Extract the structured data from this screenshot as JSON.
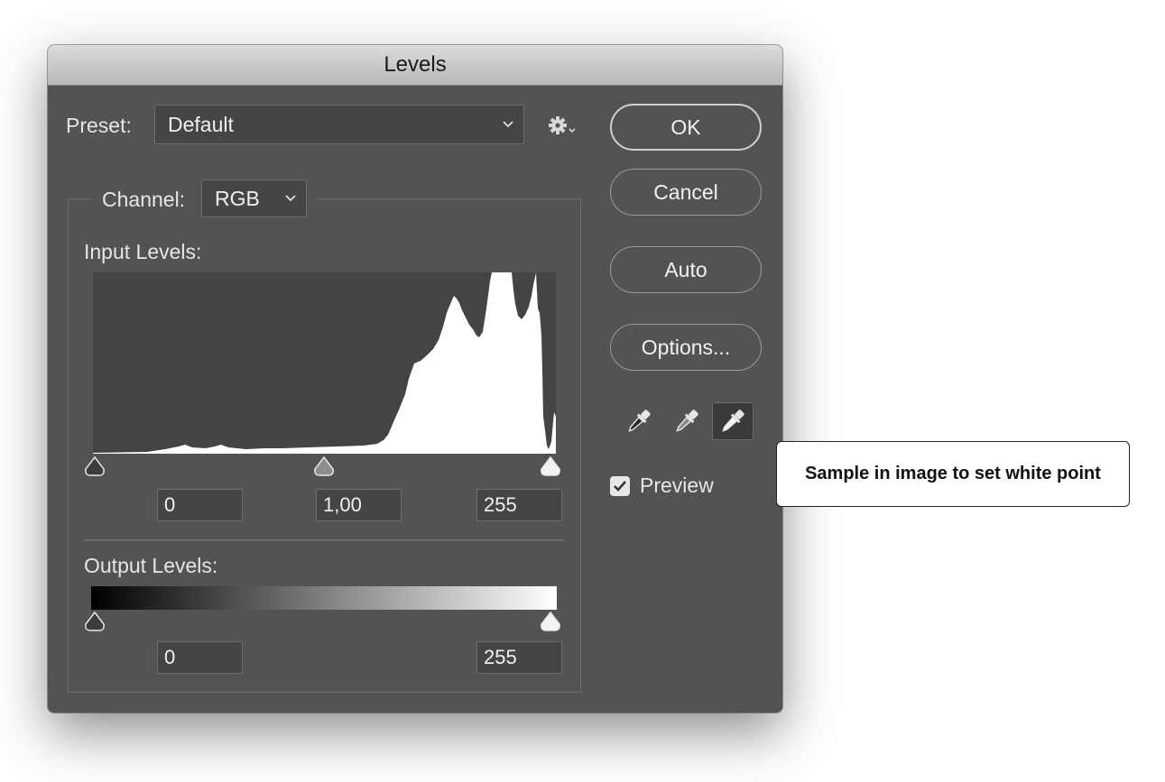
{
  "window": {
    "title": "Levels"
  },
  "preset": {
    "label": "Preset:",
    "value": "Default"
  },
  "channel": {
    "label": "Channel:",
    "value": "RGB"
  },
  "input_levels": {
    "label": "Input Levels:",
    "black": "0",
    "gamma": "1,00",
    "white": "255"
  },
  "output_levels": {
    "label": "Output Levels:",
    "black": "0",
    "white": "255"
  },
  "buttons": {
    "ok": "OK",
    "cancel": "Cancel",
    "auto": "Auto",
    "options": "Options..."
  },
  "eyedroppers": [
    {
      "icon": "black-point-eyedropper-icon",
      "active": false
    },
    {
      "icon": "gray-point-eyedropper-icon",
      "active": false
    },
    {
      "icon": "white-point-eyedropper-icon",
      "active": true
    }
  ],
  "preview": {
    "label": "Preview",
    "checked": true
  },
  "tooltip": {
    "text": "Sample in image to set white point"
  },
  "colors": {
    "dialog_bg": "#535353",
    "field_bg": "#454545",
    "histogram_bg": "#444444",
    "histogram_fill": "#ffffff"
  }
}
